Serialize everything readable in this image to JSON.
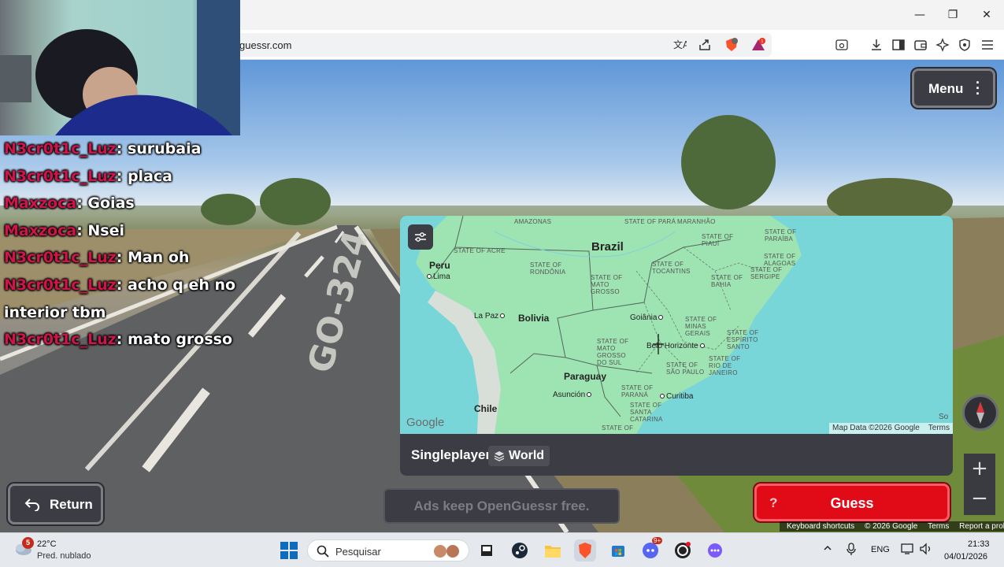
{
  "browser": {
    "url": "guessr.com",
    "window_controls": {
      "minimize": "—",
      "restore": "❐",
      "close": "✕"
    },
    "extension_badge_1": "",
    "extension_badge_2": "1"
  },
  "chat": {
    "messages": [
      {
        "user": "N3cr0t1c_Luz",
        "text": "surubaia"
      },
      {
        "user": "N3cr0t1c_Luz",
        "text": "placa"
      },
      {
        "user": "Maxzoca",
        "text": "Goias"
      },
      {
        "user": "Maxzoca",
        "text": "Nsei"
      },
      {
        "user": "N3cr0t1c_Luz",
        "text": "Man oh"
      },
      {
        "user": "N3cr0t1c_Luz",
        "text": "acho q eh no interior tbm"
      },
      {
        "user": "N3cr0t1c_Luz",
        "text": "mato grosso"
      }
    ]
  },
  "street_view": {
    "road_marking": "GO-324"
  },
  "game": {
    "menu_label": "Menu",
    "mode": "Singleplayer",
    "map_name": "World",
    "return_label": "Return",
    "ads_text": "Ads keep OpenGuessr free.",
    "guess_label": "Guess",
    "guess_prefix": "?",
    "zoom_in": "+",
    "zoom_out": "−"
  },
  "map": {
    "countries": {
      "brazil": "Brazil",
      "peru": "Peru",
      "bolivia": "Bolivia",
      "paraguay": "Paraguay",
      "chile": "Chile"
    },
    "cities": {
      "lima": "Lima",
      "la_paz": "La Paz",
      "goiania": "Goiânia",
      "belo_horizonte": "Belo Horizonte",
      "asuncion": "Asunción",
      "curitiba": "Curitiba"
    },
    "regions": {
      "amazonas": "AMAZONAS",
      "para": "STATE OF PARÁ",
      "maranhao": "MARANHÃO",
      "piaui": "STATE OF\nPIAUÍ",
      "paraiba": "STATE OF\nPARAÍBA",
      "acre": "STATE OF ACRE",
      "rondonia": "STATE OF\nRONDÔNIA",
      "tocantins": "STATE OF\nTOCANTINS",
      "alagoas": "STATE OF\nALAGOAS",
      "sergipe": "STATE OF\nSERGIPE",
      "mato_grosso": "STATE OF\nMATO\nGROSSO",
      "bahia": "STATE OF\nBAHIA",
      "minas_gerais": "STATE OF\nMINAS\nGERAIS",
      "espirito_santo": "STATE OF\nESPÍRITO\nSANTO",
      "mato_grosso_sul": "STATE OF\nMATO\nGROSSO\nDO SUL",
      "sao_paulo": "STATE OF\nSÃO PAULO",
      "rio_de_janeiro": "STATE OF\nRIO DE\nJANEIRO",
      "parana": "STATE OF\nPARANÁ",
      "santa_catarina": "STATE OF\nSANTA\nCATARINA",
      "state_of": "STATE OF"
    },
    "google_logo": "Google",
    "footer_data": "Map Data ©2026 Google",
    "footer_terms": "Terms",
    "edge_label": "So"
  },
  "street_footer": {
    "shortcuts": "Keyboard shortcuts",
    "copyright": "© 2026 Google",
    "terms": "Terms",
    "report": "Report a problem"
  },
  "taskbar": {
    "weather_temp": "22°C",
    "weather_desc": "Pred. nublado",
    "weather_badge": "5",
    "search_placeholder": "Pesquisar",
    "discord_badge": "9+",
    "language": "ENG",
    "time": "21:33",
    "date": "04/01/2026"
  },
  "colors": {
    "chat_user": "#d0134a",
    "guess_red": "#e10b17",
    "panel_dark": "#3c3d44",
    "map_water": "#78d6d8",
    "map_land": "#9ee3b2"
  }
}
